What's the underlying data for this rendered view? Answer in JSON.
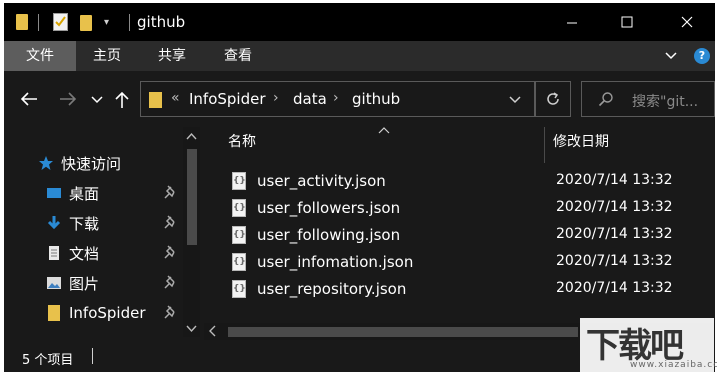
{
  "window": {
    "title": "github"
  },
  "ribbon": {
    "tabs": [
      {
        "label": "文件",
        "active": true
      },
      {
        "label": "主页",
        "active": false
      },
      {
        "label": "共享",
        "active": false
      },
      {
        "label": "查看",
        "active": false
      }
    ]
  },
  "address_bar": {
    "overflow": "«",
    "segments": [
      "InfoSpider",
      "data",
      "github"
    ],
    "separator": "›"
  },
  "search": {
    "placeholder": "搜索\"git..."
  },
  "nav_pane": {
    "quick_access": "快速访问",
    "items": [
      {
        "label": "桌面",
        "icon": "desktop-icon",
        "pinned": true
      },
      {
        "label": "下载",
        "icon": "download-icon",
        "pinned": true
      },
      {
        "label": "文档",
        "icon": "document-icon",
        "pinned": true
      },
      {
        "label": "图片",
        "icon": "pictures-icon",
        "pinned": true
      },
      {
        "label": "InfoSpider",
        "icon": "folder-icon",
        "pinned": true
      }
    ]
  },
  "columns": {
    "name": "名称",
    "modified": "修改日期"
  },
  "files": [
    {
      "name": "user_activity.json",
      "modified": "2020/7/14 13:32"
    },
    {
      "name": "user_followers.json",
      "modified": "2020/7/14 13:32"
    },
    {
      "name": "user_following.json",
      "modified": "2020/7/14 13:32"
    },
    {
      "name": "user_infomation.json",
      "modified": "2020/7/14 13:32"
    },
    {
      "name": "user_repository.json",
      "modified": "2020/7/14 13:32"
    }
  ],
  "status": {
    "count_text": "5 个项目"
  },
  "watermark": {
    "big": "下载吧",
    "small": "www.xiazaiba.com"
  },
  "colors": {
    "background": "#191919",
    "titlebar": "#000000",
    "ribbon": "#2b2b2b",
    "active_tab": "#5d5d5d",
    "folder": "#e8c14b",
    "quick_access_star": "#2a8ad4"
  }
}
